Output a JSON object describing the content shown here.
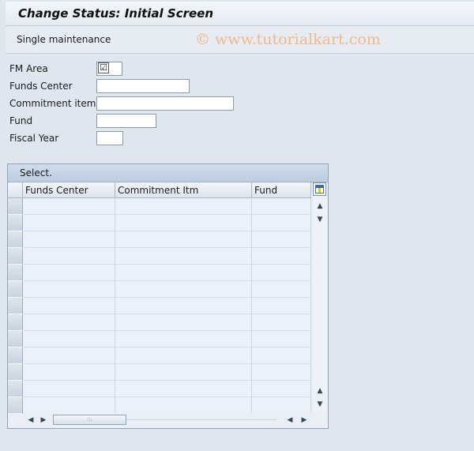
{
  "window": {
    "title": "Change Status: Initial Screen"
  },
  "toolbar": {
    "single_maintenance_label": "Single maintenance",
    "watermark": "© www.tutorialkart.com"
  },
  "form": {
    "fm_area": {
      "label": "FM Area",
      "checked": true,
      "check_glyph": "☑"
    },
    "funds_center": {
      "label": "Funds Center",
      "value": ""
    },
    "commitment_item": {
      "label": "Commitment item",
      "value": ""
    },
    "fund": {
      "label": "Fund",
      "value": ""
    },
    "fiscal_year": {
      "label": "Fiscal Year",
      "value": ""
    }
  },
  "table": {
    "title": "Select.",
    "columns": [
      "Funds Center",
      "Commitment Itm",
      "Fund"
    ],
    "rows": [
      [
        "",
        "",
        ""
      ],
      [
        "",
        "",
        ""
      ],
      [
        "",
        "",
        ""
      ],
      [
        "",
        "",
        ""
      ],
      [
        "",
        "",
        ""
      ],
      [
        "",
        "",
        ""
      ],
      [
        "",
        "",
        ""
      ],
      [
        "",
        "",
        ""
      ],
      [
        "",
        "",
        ""
      ],
      [
        "",
        "",
        ""
      ],
      [
        "",
        "",
        ""
      ],
      [
        "",
        "",
        ""
      ],
      [
        "",
        "",
        ""
      ]
    ],
    "config_icon": "table-settings-icon",
    "scroll": {
      "up": "▲",
      "down": "▼",
      "left": "◀",
      "right": "▶",
      "thumb_grip": ":::"
    }
  },
  "colors": {
    "background": "#dfe6ee",
    "header": "#dde4ec",
    "cell": "#eaf1f8",
    "watermark": "#f2b98a"
  }
}
